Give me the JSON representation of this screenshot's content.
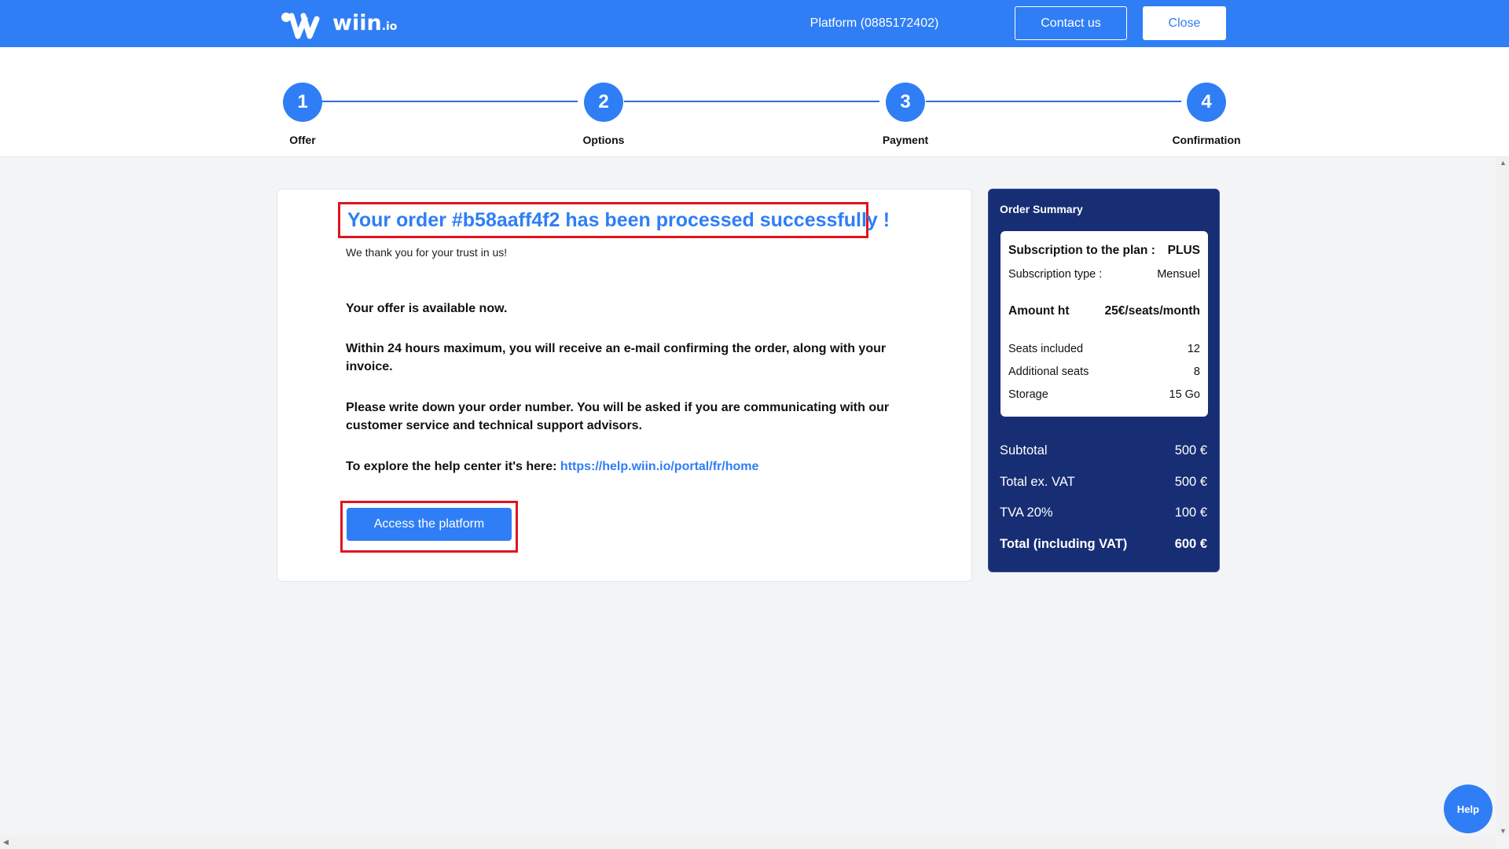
{
  "header": {
    "logo_text": "wiin",
    "logo_suffix": ".io",
    "platform_label": "Platform (0885172402)",
    "contact_label": "Contact us",
    "close_label": "Close"
  },
  "stepper": {
    "steps": [
      {
        "number": "1",
        "label": "Offer"
      },
      {
        "number": "2",
        "label": "Options"
      },
      {
        "number": "3",
        "label": "Payment"
      },
      {
        "number": "4",
        "label": "Confirmation"
      }
    ]
  },
  "confirmation": {
    "title": "Your order #b58aaff4f2 has been processed successfully !",
    "thanks": "We thank you for your trust in us!",
    "p1": "Your offer is available now.",
    "p2": "Within 24 hours maximum, you will receive an e-mail confirming the order, along with your invoice.",
    "p3": "Please write down your order number. You will be asked if you are communicating with our customer service and technical support advisors.",
    "p4_prefix": "To explore the help center it's here:",
    "help_url": "https://help.wiin.io/portal/fr/home",
    "access_label": "Access the platform"
  },
  "summary": {
    "title": "Order Summary",
    "plan_label": "Subscription to the plan :",
    "plan_value": "PLUS",
    "type_label": "Subscription type :",
    "type_value": "Mensuel",
    "amount_label": "Amount ht",
    "amount_value": "25€/seats/month",
    "seats_label": "Seats included",
    "seats_value": "12",
    "additional_label": "Additional seats",
    "additional_value": "8",
    "storage_label": "Storage",
    "storage_value": "15 Go",
    "subtotal_label": "Subtotal",
    "subtotal_value": "500 €",
    "total_ex_label": "Total ex. VAT",
    "total_ex_value": "500 €",
    "tva_label": "TVA 20%",
    "tva_value": "100 €",
    "total_label": "Total (including VAT)",
    "total_value": "600 €"
  },
  "help_label": "Help",
  "colors": {
    "brand": "#2f7ef5",
    "summary_bg": "#172e75",
    "highlight": "#e0141e"
  }
}
